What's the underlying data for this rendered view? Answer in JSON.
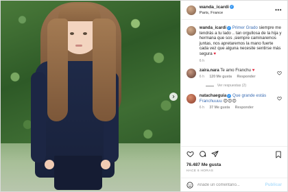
{
  "header": {
    "username": "wanda_icardi",
    "location": "Paris, France",
    "more_label": "•••"
  },
  "caption": {
    "username": "wanda_icardi",
    "text_1": "Primer Grado",
    "text_2": "siempre me tendrás a tu lado .. tan orgullosa de la hija y hermana que sos ,siempre caminaremos juntas, nos apretaremos la mano fuerte cada vez que alguna necesite sentirse más segura",
    "heart": "♥",
    "time": "6 h"
  },
  "comments": [
    {
      "username": "zaira.nara",
      "text": "Te amo Franchu",
      "heart": "♥",
      "time": "6 h",
      "likes": "120 Me gusta",
      "reply_label": "Responder",
      "view_replies": "Ver respuestas (2)"
    },
    {
      "username": "natachaeguia",
      "text": "Que grande estás Franchuuuu",
      "emoji": "😍😍😍",
      "time": "6 h",
      "likes": "37 Me gusta",
      "reply_label": "Responder"
    }
  ],
  "likes_count": "76.487 Me gusta",
  "date": "HACE 6 HORAS",
  "add_comment": {
    "placeholder": "Añade un comentario...",
    "publish_label": "Publicar"
  },
  "colors": {
    "verified": "#3897f0",
    "heart": "#e0243a",
    "mention": "#3b6db3",
    "publish_disabled": "#b2dffc"
  },
  "icons": [
    "verified-badge-icon",
    "more-options-icon",
    "heart-icon",
    "comment-icon",
    "share-icon",
    "bookmark-icon",
    "emoji-icon",
    "next-arrow-icon"
  ]
}
